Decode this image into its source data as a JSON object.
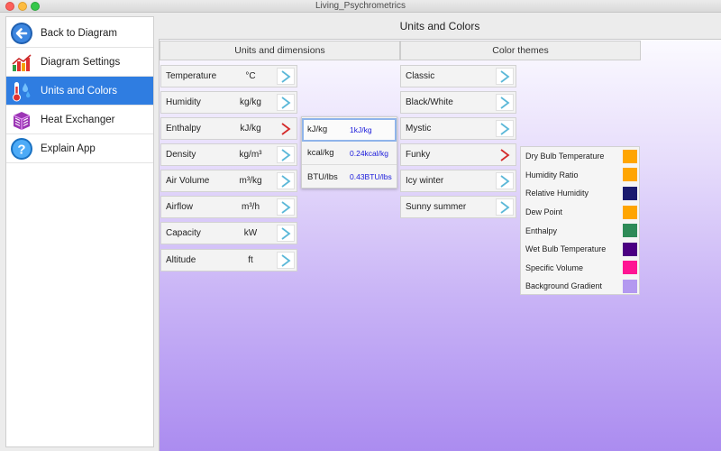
{
  "window": {
    "title": "Living_Psychrometrics"
  },
  "sidebar": {
    "items": [
      {
        "label": "Back to Diagram",
        "icon": "back-arrow-icon",
        "active": false
      },
      {
        "label": "Diagram Settings",
        "icon": "bar-chart-icon",
        "active": false
      },
      {
        "label": "Units and Colors",
        "icon": "thermometer-drops-icon",
        "active": true
      },
      {
        "label": "Heat Exchanger",
        "icon": "heat-exchanger-icon",
        "active": false
      },
      {
        "label": "Explain App",
        "icon": "help-icon",
        "active": false
      }
    ]
  },
  "main": {
    "title": "Units and Colors",
    "units_header": "Units and dimensions",
    "colors_header": "Color themes",
    "units": [
      {
        "label": "Temperature",
        "unit": "°C",
        "expanded": false
      },
      {
        "label": "Humidity",
        "unit": "kg/kg",
        "expanded": false
      },
      {
        "label": "Enthalpy",
        "unit": "kJ/kg",
        "expanded": true
      },
      {
        "label": "Density",
        "unit": "kg/m³",
        "expanded": false
      },
      {
        "label": "Air Volume",
        "unit": "m³/kg",
        "expanded": false
      },
      {
        "label": "Airflow",
        "unit": "m³/h",
        "expanded": false
      },
      {
        "label": "Capacity",
        "unit": "kW",
        "expanded": false
      },
      {
        "label": "Altitude",
        "unit": "ft",
        "expanded": false
      }
    ],
    "enthalpy_options": [
      {
        "label": "kJ/kg",
        "value": "1kJ/kg",
        "selected": true
      },
      {
        "label": "kcal/kg",
        "value": "0.24kcal/kg",
        "selected": false
      },
      {
        "label": "BTU/lbs",
        "value": "0.43BTU/lbs",
        "selected": false
      }
    ],
    "themes": [
      {
        "label": "Classic",
        "expanded": false
      },
      {
        "label": "Black/White",
        "expanded": false
      },
      {
        "label": "Mystic",
        "expanded": false
      },
      {
        "label": "Funky",
        "expanded": true
      },
      {
        "label": "Icy winter",
        "expanded": false
      },
      {
        "label": "Sunny summer",
        "expanded": false
      }
    ],
    "funky_colors": [
      {
        "label": "Dry Bulb Temperature",
        "color": "#ffa500"
      },
      {
        "label": "Humidity Ratio",
        "color": "#ffa500"
      },
      {
        "label": "Relative Humidity",
        "color": "#1a1a6e"
      },
      {
        "label": "Dew Point",
        "color": "#ffa500"
      },
      {
        "label": "Enthalpy",
        "color": "#2e8b57"
      },
      {
        "label": "Wet Bulb Temperature",
        "color": "#4b0082"
      },
      {
        "label": "Specific Volume",
        "color": "#ff1493"
      },
      {
        "label": "Background Gradient",
        "color": "#b399f0"
      }
    ],
    "colors": {
      "chevron_collapsed": "#5bb8d8",
      "chevron_expanded": "#d42a2a",
      "selection": "#2f7de1",
      "option_value": "#1a1adb"
    }
  }
}
